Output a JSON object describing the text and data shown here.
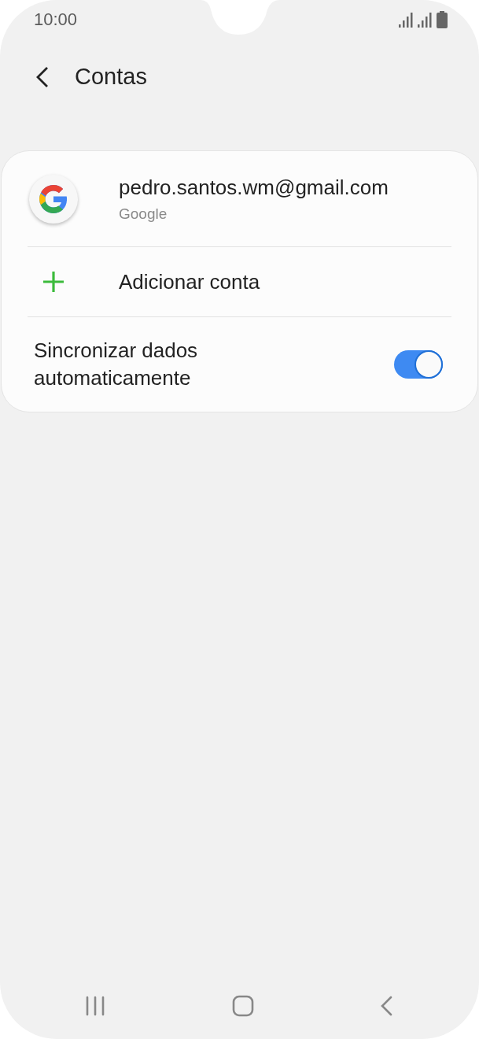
{
  "status_bar": {
    "time": "10:00"
  },
  "header": {
    "title": "Contas"
  },
  "accounts": [
    {
      "email": "pedro.santos.wm@gmail.com",
      "provider": "Google"
    }
  ],
  "add_account": {
    "label": "Adicionar conta"
  },
  "sync": {
    "label": "Sincronizar dados automaticamente",
    "on": true
  }
}
